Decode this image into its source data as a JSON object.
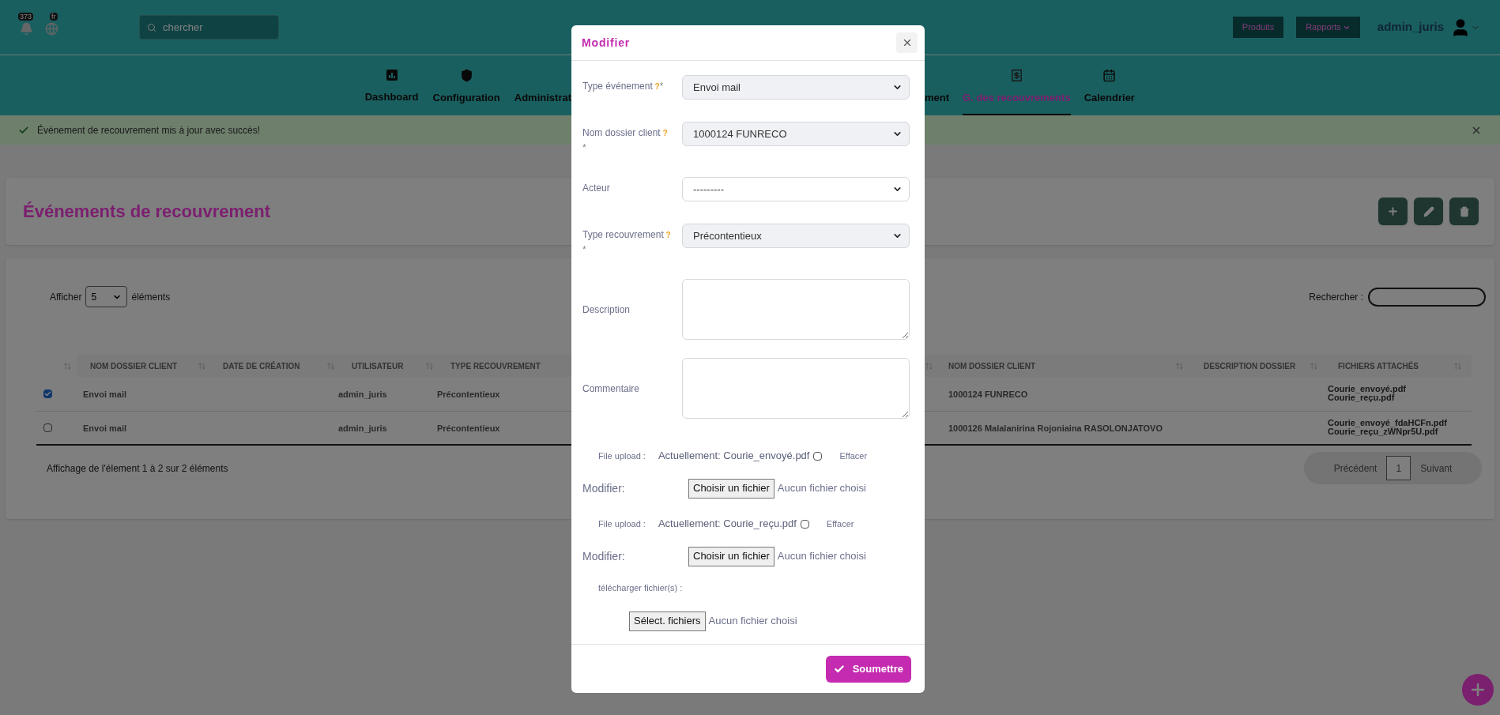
{
  "topbar": {
    "notifications_badge": "373",
    "language_badge": "fr",
    "search": {
      "placeholder": "chercher"
    },
    "links": [
      {
        "label": "Produits",
        "dropdown": false
      },
      {
        "label": "Rapports",
        "dropdown": true
      }
    ],
    "user": "admin_juris"
  },
  "nav": {
    "left": [
      {
        "label": "Dashboard",
        "selected": false
      },
      {
        "label": "Configuration",
        "selected": false
      },
      {
        "label": "Administrat",
        "selected": false
      }
    ],
    "right": [
      {
        "label": "ment",
        "selected": false
      },
      {
        "label": "G. des recouvrements",
        "selected": true
      },
      {
        "label": "Calendrier",
        "selected": false
      }
    ]
  },
  "alert": {
    "kind": "success",
    "message": "Événement de recouvrement mis à jour avec succès!"
  },
  "page_title": "Événements de recouvrement",
  "table": {
    "length": {
      "label_before": "Afficher",
      "value": "5",
      "label_after": "éléments"
    },
    "search_label": "Rechercher :",
    "columns_left": [
      "NOM DOSSIER CLIENT",
      "DATE DE CRÉATION",
      "UTILISATEUR",
      "TYPE RECOUVREMENT"
    ],
    "columns_right": [
      "NOM DOSSIER CLIENT",
      "DESCRIPTION DOSSIER",
      "FICHIERS ATTACHÉS"
    ],
    "rows": [
      {
        "selected": true,
        "nom_dossier_client": "Envoi mail",
        "utilisateur": "admin_juris",
        "type_recouvrement": "Précontentieux",
        "nom_dossier_client_2": "1000124 FUNRECO",
        "fichiers_attaches": [
          "Courie_envoyé.pdf",
          "Courie_reçu.pdf"
        ]
      },
      {
        "selected": false,
        "nom_dossier_client": "Envoi mail",
        "utilisateur": "admin_juris",
        "type_recouvrement": "Précontentieux",
        "nom_dossier_client_2": "1000126 Malalanirina Rojoniaina RASOLONJATOVO",
        "fichiers_attaches": [
          "Courie_envoyé_fdaHCFn.pdf",
          "Courie_reçu_zWNpr5U.pdf"
        ]
      }
    ],
    "info": "Affichage de l'élement 1 à 2 sur 2 éléments",
    "pagination": {
      "previous": "Précédent",
      "pages": [
        {
          "label": "1",
          "selected": true
        }
      ],
      "next": "Suivant"
    }
  },
  "modal": {
    "title": "Modifier",
    "fields": [
      {
        "kind": "select",
        "label": "Type événement",
        "help": "?",
        "required": "*",
        "value": "Envoi mail",
        "disabled": true
      },
      {
        "kind": "select",
        "label": "Nom dossier client",
        "help": "?",
        "required": "*",
        "value": "1000124 FUNRECO",
        "disabled": true
      },
      {
        "kind": "select",
        "label": "Acteur",
        "value": "---------",
        "disabled": false
      },
      {
        "kind": "select",
        "label": "Type recouvrement",
        "help": "?",
        "required": "*",
        "value": "Précontentieux",
        "disabled": true
      },
      {
        "kind": "textarea",
        "label": "Description"
      },
      {
        "kind": "textarea",
        "label": "Commentaire"
      },
      {
        "kind": "current_file",
        "label": "File upload :",
        "current_label": "Actuellement:",
        "filename": "Courie_envoyé.pdf",
        "clear_checked": false,
        "clear_label": "Effacer"
      },
      {
        "kind": "file_input",
        "label": "Modifier:",
        "button": "Choisir un fichier",
        "status": "Aucun fichier choisi"
      },
      {
        "kind": "current_file",
        "label": "File upload :",
        "current_label": "Actuellement:",
        "filename": "Courie_reçu.pdf",
        "clear_checked": false,
        "clear_label": "Effacer"
      },
      {
        "kind": "file_input",
        "label": "Modifier:",
        "button": "Choisir un fichier",
        "status": "Aucun fichier choisi"
      },
      {
        "kind": "heading",
        "label": "télécharger fichier(s) :"
      },
      {
        "kind": "file_input",
        "button": "Sélect. fichiers",
        "status": "Aucun fichier choisi"
      }
    ],
    "submit": "Soumettre"
  }
}
